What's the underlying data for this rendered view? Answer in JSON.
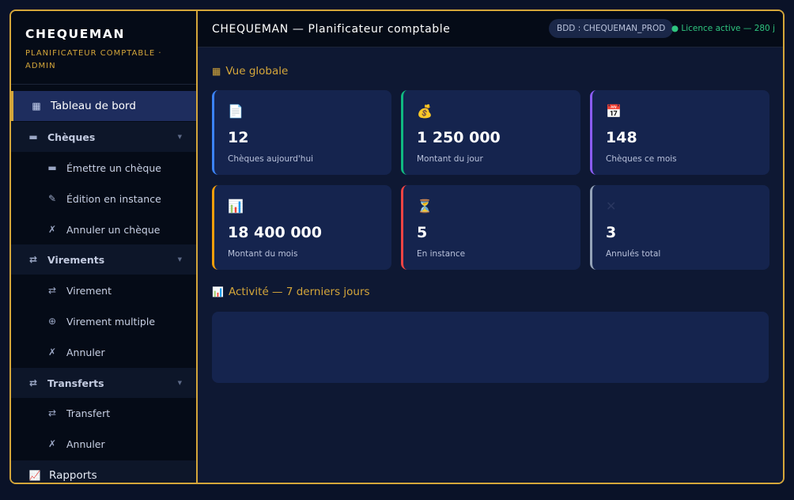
{
  "brand": {
    "title": "CHEQUEMAN",
    "subtitle_line1": "PLANIFICATEUR COMPTABLE ·",
    "subtitle_line2": "ADMIN"
  },
  "sidebar": {
    "dashboard": {
      "label": "Tableau de bord",
      "icon": "grid-icon"
    },
    "cheques": {
      "label": "Chèques",
      "icon": "cheque-icon"
    },
    "cheques_items": [
      {
        "label": "Émettre un chèque",
        "icon": "pen-icon"
      },
      {
        "label": "Édition en instance",
        "icon": "pencil-icon"
      },
      {
        "label": "Annuler un chèque",
        "icon": "cross-icon"
      }
    ],
    "virements": {
      "label": "Virements",
      "icon": "arrows-icon"
    },
    "virements_items": [
      {
        "label": "Virement",
        "icon": "arrows-icon"
      },
      {
        "label": "Virement multiple",
        "icon": "plus-circle-icon"
      },
      {
        "label": "Annuler",
        "icon": "cross-icon"
      }
    ],
    "transferts": {
      "label": "Transferts",
      "icon": "arrows-icon"
    },
    "transferts_items": [
      {
        "label": "Transfert",
        "icon": "arrows-icon"
      },
      {
        "label": "Annuler",
        "icon": "cross-icon"
      }
    ],
    "reports": {
      "label": "Rapports",
      "icon": "chart-icon"
    }
  },
  "topbar": {
    "title": "CHEQUEMAN — Planificateur comptable",
    "db_badge": "BDD : CHEQUEMAN_PROD",
    "licence": "● Licence active — 280 j"
  },
  "overview": {
    "title": "Vue globale",
    "cards": [
      {
        "value": "12",
        "label": "Chèques aujourd'hui",
        "icon": "document-icon",
        "accent": "#3b82f6"
      },
      {
        "value": "1 250 000",
        "label": "Montant du jour",
        "icon": "money-bag-icon",
        "accent": "#10b981"
      },
      {
        "value": "148",
        "label": "Chèques ce mois",
        "icon": "calendar-icon",
        "accent": "#8b5cf6"
      },
      {
        "value": "18 400 000",
        "label": "Montant du mois",
        "icon": "bar-chart-icon",
        "accent": "#f59e0b"
      },
      {
        "value": "5",
        "label": "En instance",
        "icon": "hourglass-icon",
        "accent": "#ef4444"
      },
      {
        "value": "3",
        "label": "Annulés total",
        "icon": "cross-icon",
        "accent": "#94a3b8"
      }
    ]
  },
  "activity": {
    "title": "Activité — 7 derniers jours"
  },
  "colors": {
    "gold": "#d4a63a",
    "licence_green": "#2fc57f"
  }
}
